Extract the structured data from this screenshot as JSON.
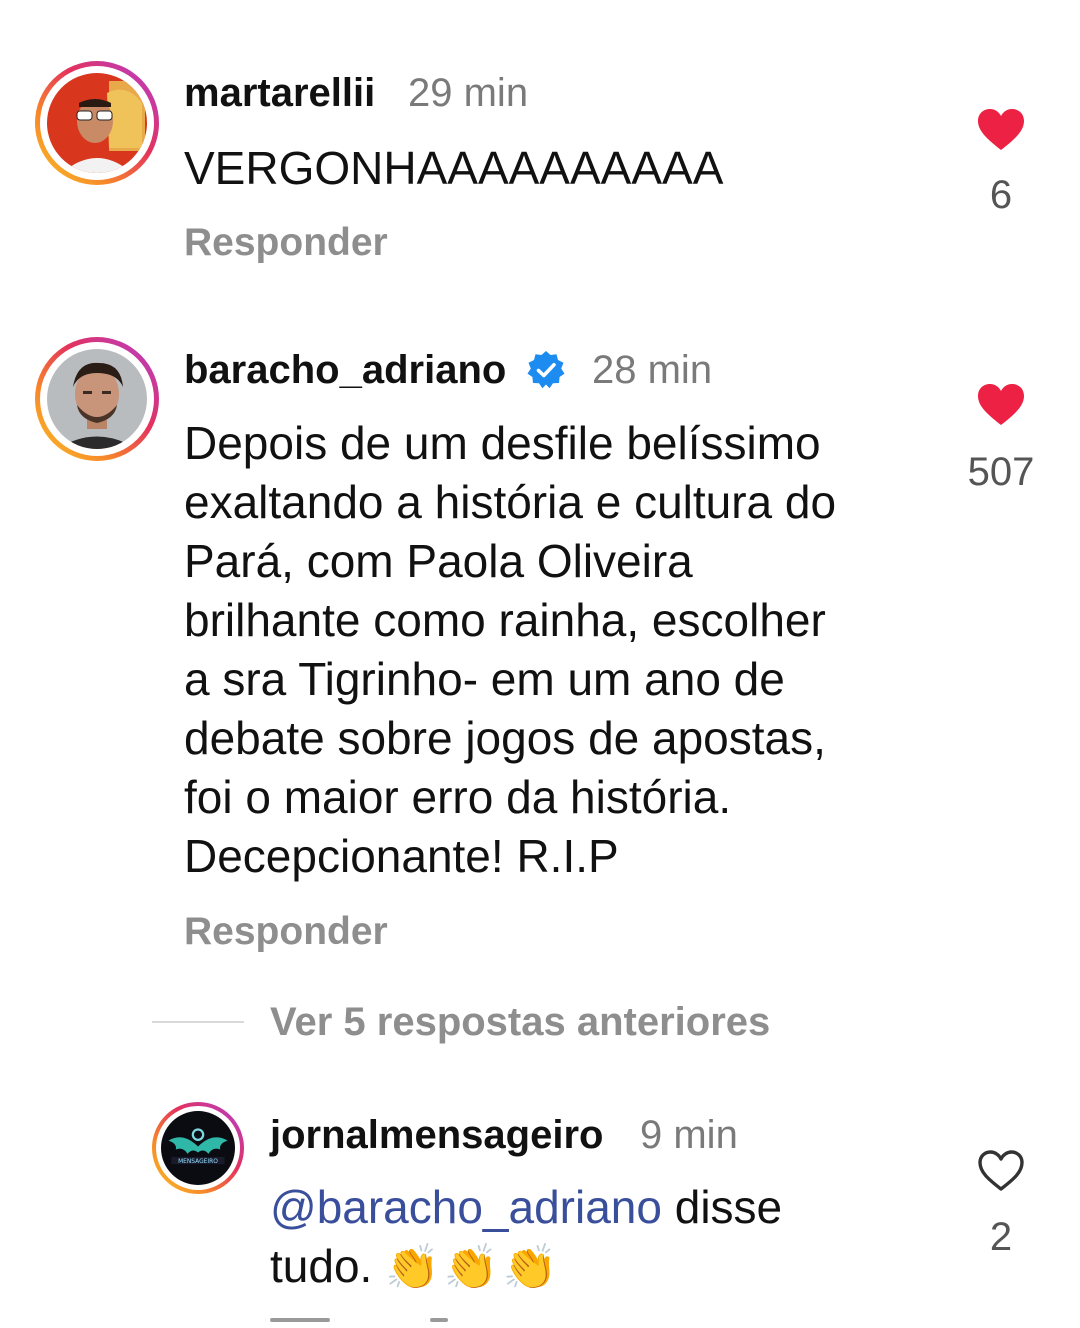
{
  "comments": [
    {
      "username": "martarellii",
      "time": "29 min",
      "text_lines": [
        "VERGONHAAAAAAAAAA"
      ],
      "reply_label": "Responder",
      "likes": "6",
      "liked": true,
      "verified": false
    },
    {
      "username": "baracho_adriano",
      "time": "28 min",
      "text_lines": [
        "Depois de um desfile belíssimo",
        "exaltando a história e cultura  do",
        "Pará, com Paola Oliveira",
        "brilhante como rainha, escolher",
        "a sra Tigrinho- em um ano de",
        "debate sobre jogos de apostas,",
        "foi o maior erro da história.",
        "Decepcionante! R.I.P"
      ],
      "reply_label": "Responder",
      "likes": "507",
      "liked": true,
      "verified": true
    }
  ],
  "view_replies_label": "Ver 5 respostas anteriores",
  "reply": {
    "username": "jornalmensageiro",
    "time": "9 min",
    "mention": "@baracho_adriano",
    "text_after_mention": " disse",
    "text_line2": "tudo. ",
    "emoji": "👏👏👏",
    "likes": "2",
    "liked": false,
    "avatar_logo_text": "MENSAGEIRO"
  },
  "colors": {
    "heart_filled": "#ed2143",
    "mention": "#3a4f9b",
    "muted": "#8e8e8e",
    "verified": "#1d8cf0"
  },
  "icons": {
    "heart_filled": "heart-filled-icon",
    "heart_outline": "heart-outline-icon",
    "verified": "verified-badge-icon",
    "clap": "clapping-hands-emoji"
  }
}
